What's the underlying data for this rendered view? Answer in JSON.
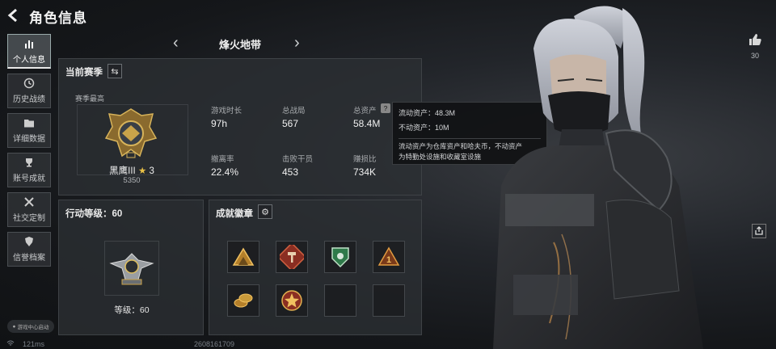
{
  "header": {
    "title": "角色信息"
  },
  "sidebar": {
    "items": [
      {
        "label": "个人信息",
        "icon": "bar-chart-icon",
        "active": true
      },
      {
        "label": "历史战绩",
        "icon": "history-icon"
      },
      {
        "label": "详细数据",
        "icon": "folder-icon"
      },
      {
        "label": "账号成就",
        "icon": "trophy-icon"
      },
      {
        "label": "社交定制",
        "icon": "tools-icon"
      },
      {
        "label": "信誉档案",
        "icon": "shield-icon"
      }
    ],
    "game_center": "游戏中心启动"
  },
  "season_selector": {
    "name": "烽火地带"
  },
  "season_panel": {
    "title": "当前赛季",
    "rank_caption": "赛季最高",
    "rank_name": "黑鹰III",
    "rank_stars": "3",
    "rank_points": "5350",
    "stats": [
      {
        "label": "游戏时长",
        "value": "97h"
      },
      {
        "label": "总战局",
        "value": "567"
      },
      {
        "label": "总资产",
        "value": "58.4M"
      },
      {
        "label": "撤离率",
        "value": "22.4%"
      },
      {
        "label": "击败干员",
        "value": "453"
      },
      {
        "label": "赚损比",
        "value": "734K"
      }
    ]
  },
  "tooltip": {
    "liquid": "流动资产：48.3M",
    "fixed": "不动资产：10M",
    "desc_line1": "流动资产为仓库资产和哈夫币，不动资产",
    "desc_line2": "为特勤处设施和收藏室设施"
  },
  "action_level_panel": {
    "title": "行动等级：60",
    "level_text": "等级：60"
  },
  "badges_panel": {
    "title": "成就徽章"
  },
  "right": {
    "likes": "30"
  },
  "footer": {
    "ping": "121ms",
    "player_id": "2608161709"
  },
  "colors": {
    "accent": "#e8e8e8",
    "gold": "#c9a34a",
    "badge_red": "#b5402a",
    "badge_green": "#2f7a4a"
  }
}
